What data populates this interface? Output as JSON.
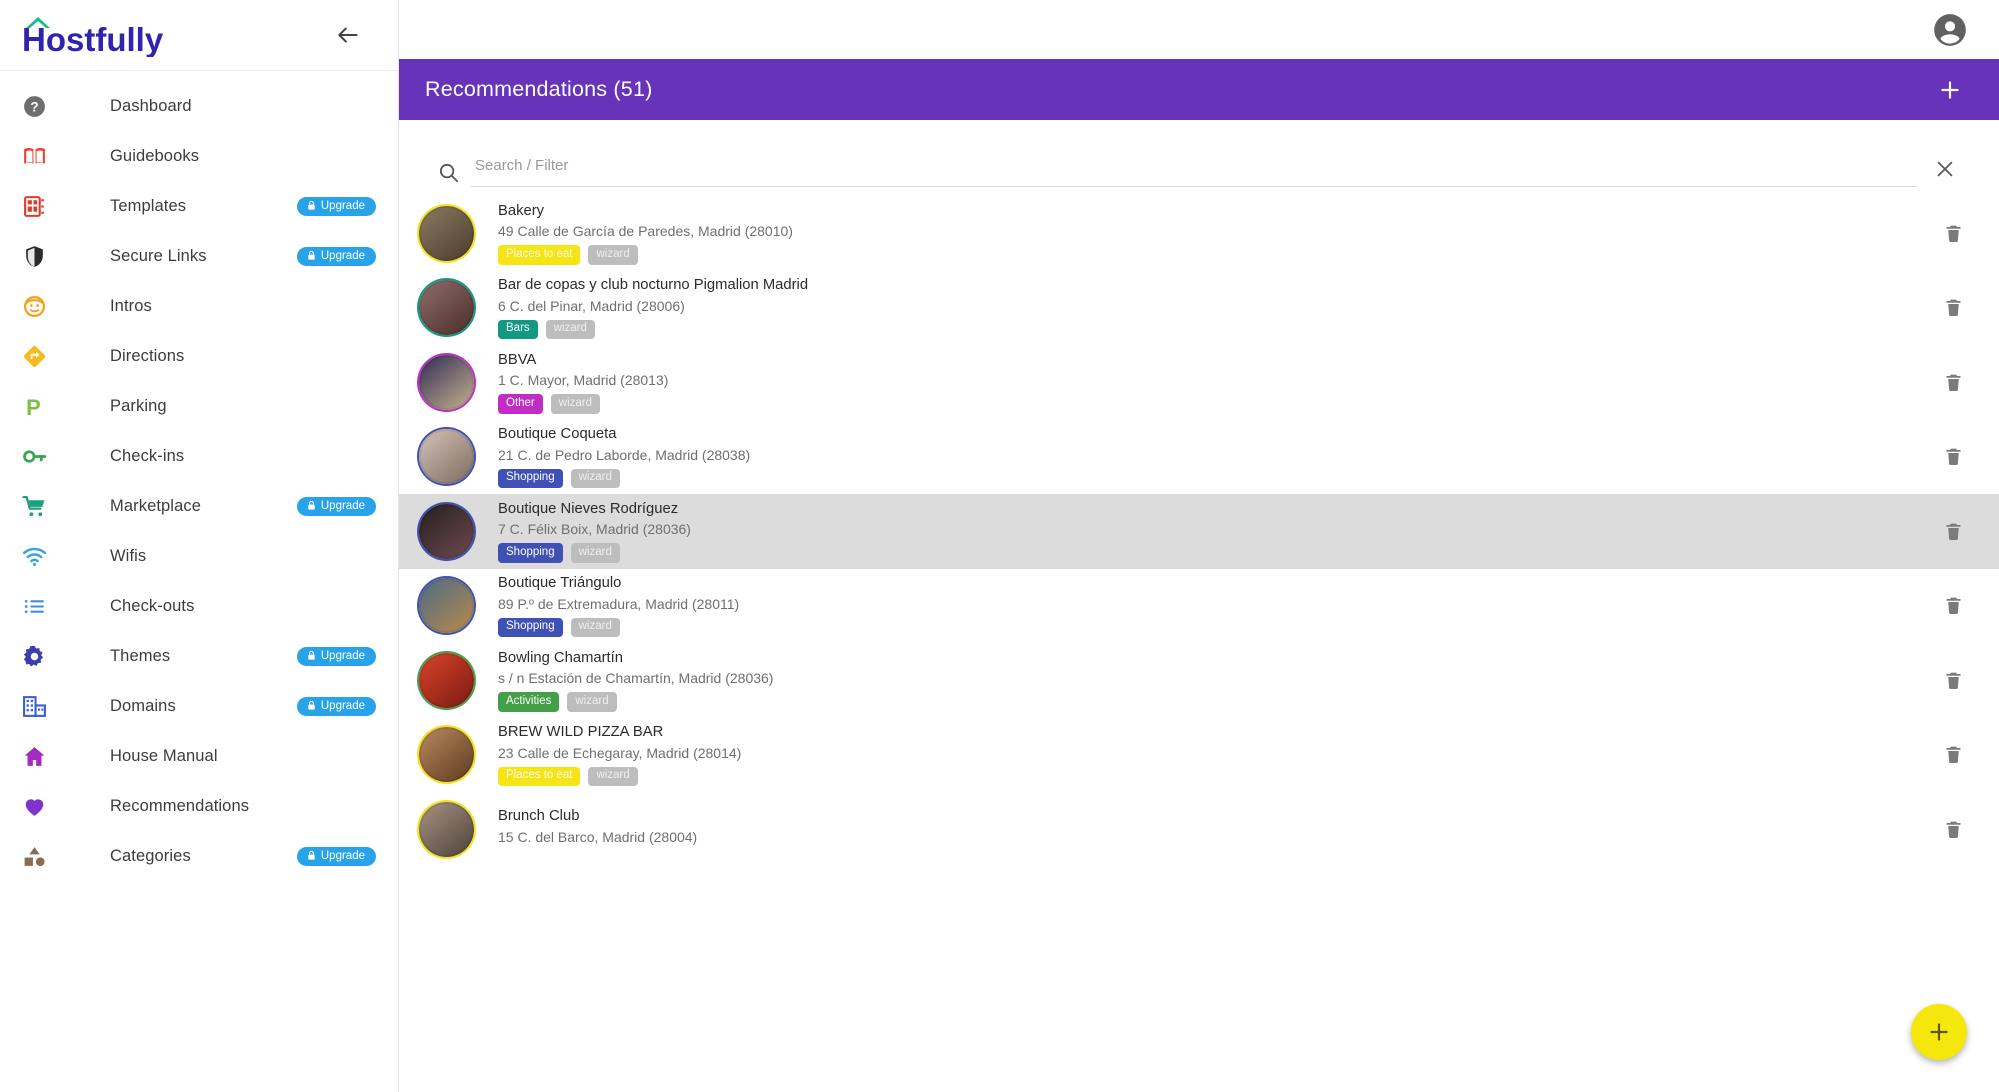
{
  "brand": {
    "name": "Hostfully",
    "logo_colors": {
      "text": "#3023ae",
      "roof": "#19bd8c"
    }
  },
  "sidebar": {
    "back_label": "back-arrow",
    "upgrade_label": "Upgrade",
    "items": [
      {
        "label": "Dashboard",
        "icon": "help-circle-icon",
        "color": "#6e6e6e",
        "upgrade": false
      },
      {
        "label": "Guidebooks",
        "icon": "book-icon",
        "color": "#f4402f",
        "upgrade": false
      },
      {
        "label": "Templates",
        "icon": "template-icon",
        "color": "#e03a2b",
        "upgrade": true
      },
      {
        "label": "Secure Links",
        "icon": "shield-icon",
        "color": "#2b2b2b",
        "upgrade": true
      },
      {
        "label": "Intros",
        "icon": "person-face-icon",
        "color": "#f5a01e",
        "upgrade": false
      },
      {
        "label": "Directions",
        "icon": "directions-icon",
        "color": "#f5bb1e",
        "upgrade": false
      },
      {
        "label": "Parking",
        "icon": "parking-icon",
        "color": "#7ac143",
        "upgrade": false
      },
      {
        "label": "Check-ins",
        "icon": "key-icon",
        "color": "#34a84f",
        "upgrade": false
      },
      {
        "label": "Marketplace",
        "icon": "cart-icon",
        "color": "#1aa07a",
        "upgrade": true
      },
      {
        "label": "Wifis",
        "icon": "wifi-icon",
        "color": "#3aa3e3",
        "upgrade": false
      },
      {
        "label": "Check-outs",
        "icon": "list-icon",
        "color": "#3f8ddc",
        "upgrade": false
      },
      {
        "label": "Themes",
        "icon": "gear-icon",
        "color": "#3a3fb0",
        "upgrade": true
      },
      {
        "label": "Domains",
        "icon": "building-icon",
        "color": "#3a5fd0",
        "upgrade": true
      },
      {
        "label": "House Manual",
        "icon": "home-icon",
        "color": "#a32bbf",
        "upgrade": false
      },
      {
        "label": "Recommendations",
        "icon": "heart-icon",
        "color": "#7e33cc",
        "upgrade": false
      },
      {
        "label": "Categories",
        "icon": "categories-icon",
        "color": "#8a6b52",
        "upgrade": true
      }
    ]
  },
  "header": {
    "title": "Recommendations (51)",
    "add_icon": "plus-icon",
    "background": "#6633b9"
  },
  "search": {
    "placeholder": "Search / Filter",
    "value": "",
    "search_icon": "search-icon",
    "clear_icon": "close-icon"
  },
  "tag_colors": {
    "Places to eat": "#f5e416",
    "Bars": "#119a81",
    "Other": "#bf2dc4",
    "Shopping": "#3f51b5",
    "Activities": "#43a047",
    "wizard": "#bdbdbd"
  },
  "fab": {
    "icon": "plus-icon",
    "color": "#f5e60c"
  },
  "delete_icon": "trash-icon",
  "list": {
    "row_delete_label": "Delete",
    "items": [
      {
        "name": "Bakery",
        "address": "49 Calle de García de Paredes, Madrid (28010)",
        "tags": [
          "Places to eat",
          "wizard"
        ],
        "thumb_colors": [
          "#8c7a63",
          "#4b3b2b"
        ],
        "ring": "#f5e416",
        "hovered": false
      },
      {
        "name": "Bar de copas y club nocturno Pigmalion Madrid",
        "address": "6 C. del Pinar, Madrid (28006)",
        "tags": [
          "Bars",
          "wizard"
        ],
        "thumb_colors": [
          "#8e6f6a",
          "#4a2c2a"
        ],
        "ring": "#119a81",
        "hovered": false
      },
      {
        "name": "BBVA",
        "address": "1 C. Mayor, Madrid (28013)",
        "tags": [
          "Other",
          "wizard"
        ],
        "thumb_colors": [
          "#2f2a55",
          "#c8b48e"
        ],
        "ring": "#bf2dc4",
        "hovered": false
      },
      {
        "name": "Boutique Coqueta",
        "address": "21 C. de Pedro Laborde, Madrid (28038)",
        "tags": [
          "Shopping",
          "wizard"
        ],
        "thumb_colors": [
          "#d6c4bb",
          "#7b6a5d"
        ],
        "ring": "#3f51b5",
        "hovered": false
      },
      {
        "name": "Boutique Nieves Rodríguez",
        "address": "7 C. Félix Boix, Madrid (28036)",
        "tags": [
          "Shopping",
          "wizard"
        ],
        "thumb_colors": [
          "#241f1e",
          "#6e4a52"
        ],
        "ring": "#3f51b5",
        "hovered": true
      },
      {
        "name": "Boutique Triángulo",
        "address": "89 P.º de Extremadura, Madrid (28011)",
        "tags": [
          "Shopping",
          "wizard"
        ],
        "thumb_colors": [
          "#4a6b86",
          "#b98a4a"
        ],
        "ring": "#3f51b5",
        "hovered": false
      },
      {
        "name": "Bowling Chamartín",
        "address": "s / n Estación de Chamartín, Madrid (28036)",
        "tags": [
          "Activities",
          "wizard"
        ],
        "thumb_colors": [
          "#d9442a",
          "#7a1a12"
        ],
        "ring": "#43a047",
        "hovered": false
      },
      {
        "name": "BREW WILD PIZZA BAR",
        "address": "23 Calle de Echegaray, Madrid (28014)",
        "tags": [
          "Places to eat",
          "wizard"
        ],
        "thumb_colors": [
          "#b98a5e",
          "#5d3a22"
        ],
        "ring": "#f5e416",
        "hovered": false
      },
      {
        "name": "Brunch Club",
        "address": "15 C. del Barco, Madrid (28004)",
        "tags": [],
        "thumb_colors": [
          "#a79484",
          "#4e4138"
        ],
        "ring": "#f5e416",
        "hovered": false
      }
    ]
  }
}
